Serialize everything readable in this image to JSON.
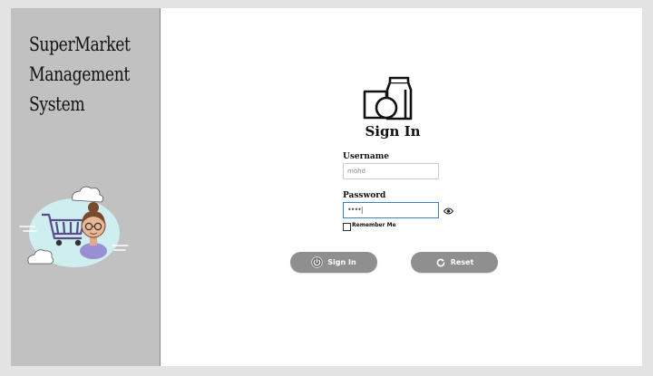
{
  "sidebar": {
    "app_title": "SuperMarket\nManagement\nSystem"
  },
  "login": {
    "title": "Sign In",
    "username_label": "Username",
    "username_value": "mohd",
    "password_label": "Password",
    "password_value": "••••|",
    "remember_label": "Remember Me",
    "signin_label": "Sign In",
    "reset_label": "Reset"
  },
  "icons": {
    "logo": "grocery-packages-icon",
    "show_password": "eye-icon",
    "signin": "power-icon",
    "reset": "refresh-icon"
  },
  "colors": {
    "sidebar_bg": "#c1c1c1",
    "button_bg": "#8f8f8f",
    "focus_border": "#3d7ddb",
    "cloud": "#cfeef0"
  }
}
